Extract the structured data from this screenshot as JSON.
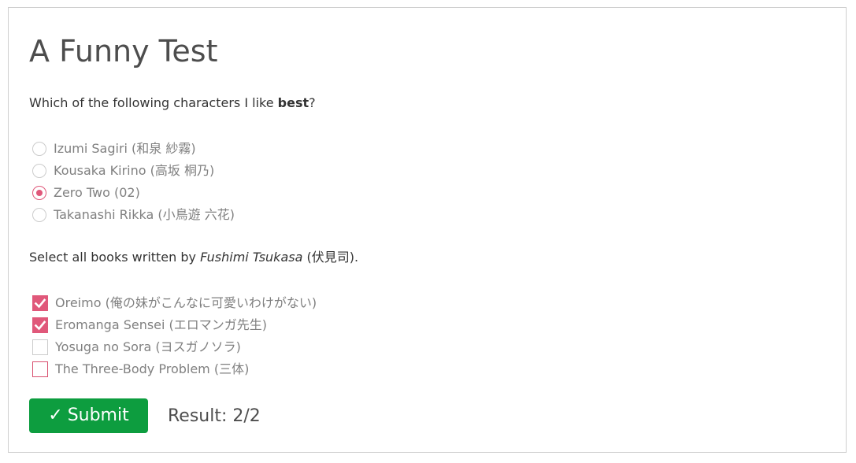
{
  "title": "A Funny Test",
  "question1": {
    "prefix": "Which of the following characters I like ",
    "emphasis": "best",
    "suffix": "?",
    "options": [
      {
        "label": "Izumi Sagiri (和泉 紗霧)",
        "selected": false
      },
      {
        "label": "Kousaka Kirino (高坂 桐乃)",
        "selected": false
      },
      {
        "label": "Zero Two (02)",
        "selected": true
      },
      {
        "label": "Takanashi Rikka (小鳥遊 六花)",
        "selected": false
      }
    ]
  },
  "question2": {
    "prefix": "Select all books written by ",
    "emphasis": "Fushimi Tsukasa",
    "suffix": " (伏見司).",
    "options": [
      {
        "label": "Oreimo (俺の妹がこんなに可愛いわけがない)",
        "checked": true
      },
      {
        "label": "Eromanga Sensei (エロマンガ先生)",
        "checked": true
      },
      {
        "label": "Yosuga no Sora (ヨスガノソラ)",
        "checked": false
      },
      {
        "label": "The Three-Body Problem (三体)",
        "checked": false
      }
    ]
  },
  "submit": {
    "icon": "✓",
    "label": "Submit"
  },
  "result": "Result: 2/2",
  "colors": {
    "accent": "#e0587a",
    "submit": "#0d9d3f",
    "border": "#cfcfcf"
  }
}
